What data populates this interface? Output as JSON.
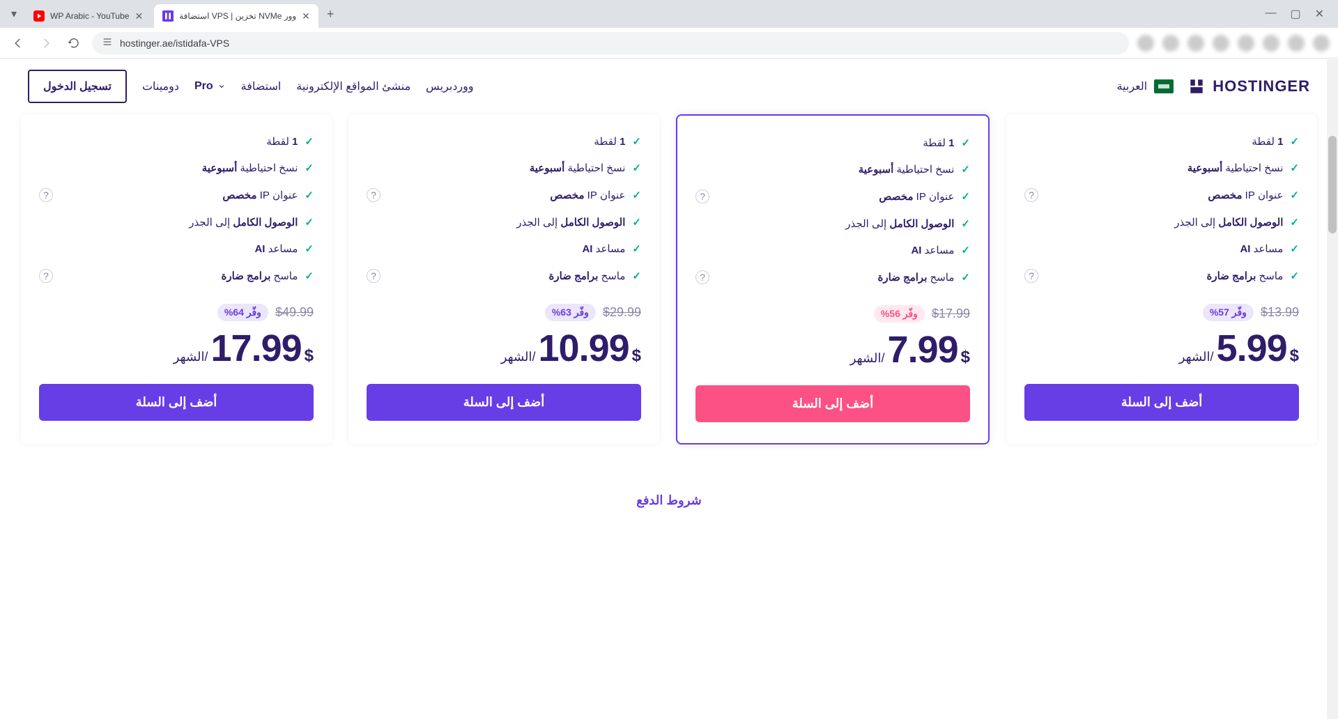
{
  "browser": {
    "tabs": [
      {
        "title": "WP Arabic - YouTube",
        "active": false
      },
      {
        "title": "استضافة VPS | تخزين NVMe وور",
        "active": true
      }
    ],
    "url": "hostinger.ae/istidafa-VPS"
  },
  "header": {
    "login": "تسجيل الدخول",
    "nav": {
      "domains": "دومينات",
      "pro": "Pro",
      "hosting": "استضافة",
      "builder": "منشئ المواقع الإلكترونية",
      "wordpress": "ووردبريس"
    },
    "language": "العربية",
    "brand": "HOSTINGER"
  },
  "features_common": [
    {
      "prefix": "",
      "bold": "1",
      "suffix": " لقطة",
      "info": false
    },
    {
      "prefix": "نسخ احتياطية ",
      "bold": "أسبوعية",
      "suffix": "",
      "info": false
    },
    {
      "prefix": "عنوان IP ",
      "bold": "مخصص",
      "suffix": "",
      "info": true
    },
    {
      "prefix": "",
      "bold": "الوصول الكامل",
      "suffix": " إلى الجذر",
      "info": false
    },
    {
      "prefix": "مساعد ",
      "bold": "AI",
      "suffix": "",
      "info": false
    },
    {
      "prefix": "ماسح ",
      "bold": "برامج ضارة",
      "suffix": "",
      "info": true
    }
  ],
  "plans": [
    {
      "old_price": "$13.99",
      "save": "وفّر 57%",
      "currency": "$",
      "amount": "5.99",
      "period": "/الشهر",
      "cta": "أضف إلى السلة",
      "highlight": false,
      "pink": false
    },
    {
      "old_price": "$17.99",
      "save": "وفّر 56%",
      "currency": "$",
      "amount": "7.99",
      "period": "/الشهر",
      "cta": "أضف إلى السلة",
      "highlight": true,
      "pink": true
    },
    {
      "old_price": "$29.99",
      "save": "وفّر 63%",
      "currency": "$",
      "amount": "10.99",
      "period": "/الشهر",
      "cta": "أضف إلى السلة",
      "highlight": false,
      "pink": false
    },
    {
      "old_price": "$49.99",
      "save": "وفّر 64%",
      "currency": "$",
      "amount": "17.99",
      "period": "/الشهر",
      "cta": "أضف إلى السلة",
      "highlight": false,
      "pink": false
    }
  ],
  "footer_link": "شروط الدفع"
}
